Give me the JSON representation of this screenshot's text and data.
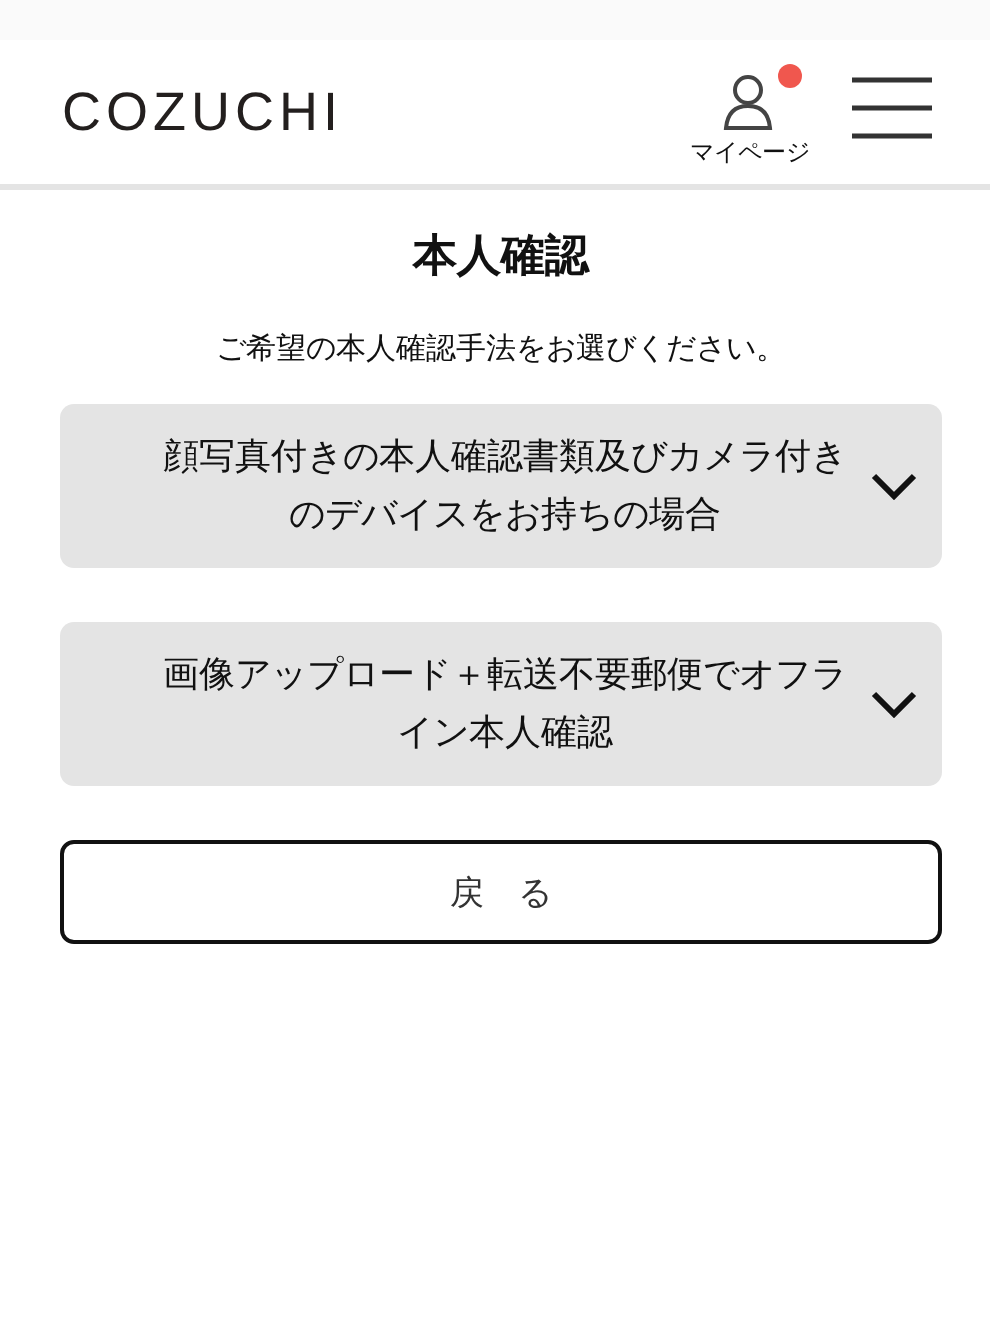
{
  "header": {
    "logo": "COZUCHI",
    "mypage": {
      "label": "マイページ",
      "notification": true
    }
  },
  "title": "本人確認",
  "instruction": "ご希望の本人確認手法をお選びください。",
  "options": [
    {
      "label": "顔写真付きの本人確認書類及びカメラ付きのデバイスをお持ちの場合",
      "expanded": false
    },
    {
      "label": "画像アップロード＋転送不要郵便でオフライン本人確認",
      "expanded": false
    }
  ],
  "back_button": "戻　る"
}
